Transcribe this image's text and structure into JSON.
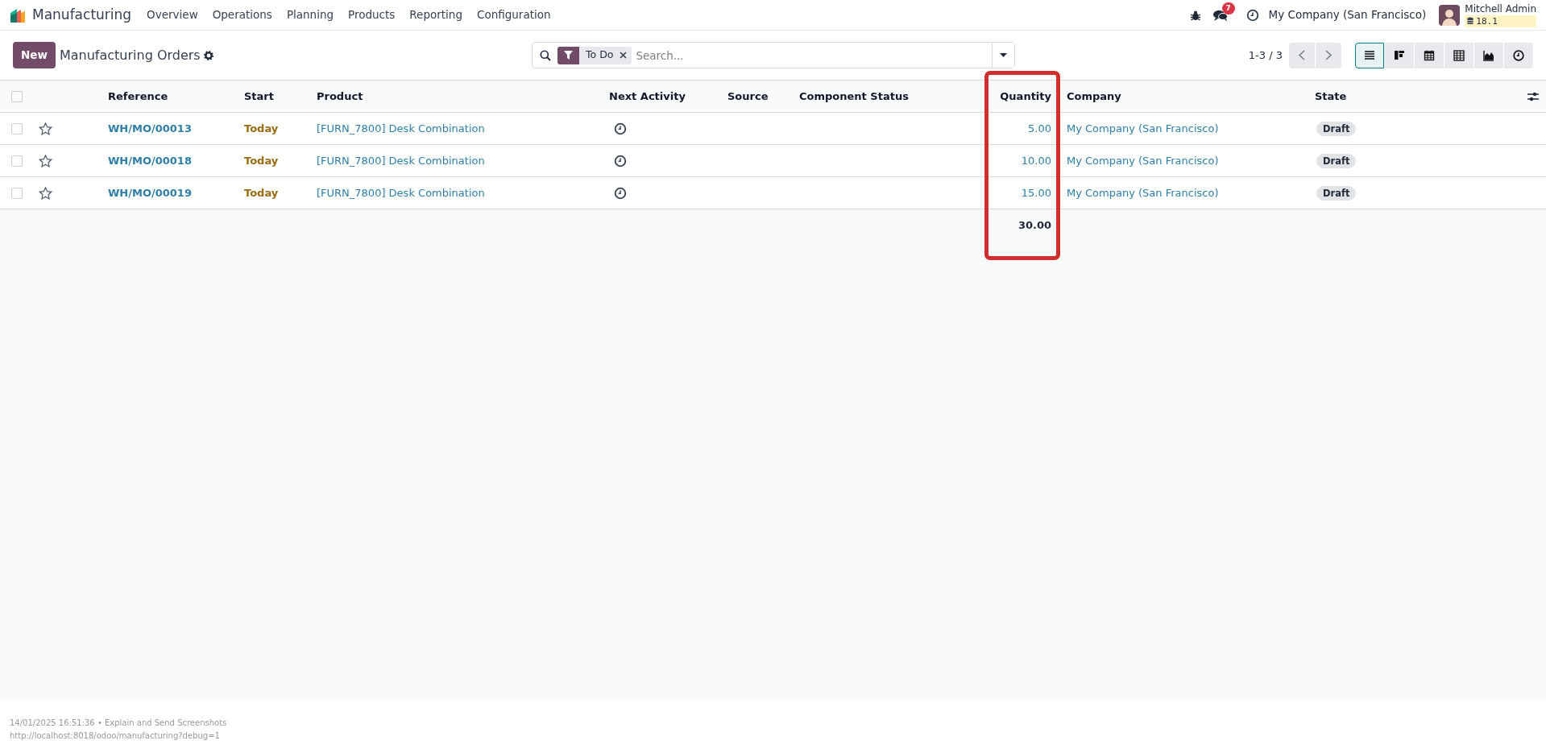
{
  "navbar": {
    "app_name": "Manufacturing",
    "menu": [
      "Overview",
      "Operations",
      "Planning",
      "Products",
      "Reporting",
      "Configuration"
    ],
    "chat_count": "7",
    "company": "My Company (San Francisco)",
    "user_name": "Mitchell Admin",
    "db_version": "18.1"
  },
  "control_panel": {
    "new_button": "New",
    "breadcrumb": "Manufacturing Orders",
    "search": {
      "facets": [
        {
          "label": "To Do"
        }
      ],
      "placeholder": "Search..."
    },
    "pager": "1-3 / 3",
    "views": [
      {
        "kind": "list",
        "selected": true
      },
      {
        "kind": "kanban",
        "selected": false
      },
      {
        "kind": "calendar",
        "selected": false
      },
      {
        "kind": "pivot",
        "selected": false
      },
      {
        "kind": "graph",
        "selected": false
      },
      {
        "kind": "activity",
        "selected": false
      }
    ]
  },
  "table": {
    "select_all_checked": false,
    "columns": [
      "Reference",
      "Start",
      "Product",
      "Next Activity",
      "Source",
      "Component Status",
      "Quantity",
      "Company",
      "State"
    ],
    "rows": [
      {
        "checked": false,
        "starred": false,
        "reference": "WH/MO/00013",
        "start": "Today",
        "product": "[FURN_7800] Desk Combination",
        "quantity": "5.00",
        "company": "My Company (San Francisco)",
        "state": "Draft"
      },
      {
        "checked": false,
        "starred": false,
        "reference": "WH/MO/00018",
        "start": "Today",
        "product": "[FURN_7800] Desk Combination",
        "quantity": "10.00",
        "company": "My Company (San Francisco)",
        "state": "Draft"
      },
      {
        "checked": false,
        "starred": false,
        "reference": "WH/MO/00019",
        "start": "Today",
        "product": "[FURN_7800] Desk Combination",
        "quantity": "15.00",
        "company": "My Company (San Francisco)",
        "state": "Draft"
      }
    ],
    "total": "30.00"
  },
  "annotations": [
    {
      "kind": "rectangle"
    }
  ],
  "footer": {
    "line_1": "14/01/2025 16:51:36 • Explain and Send Screenshots",
    "line_2": "http://localhost:8018/odoo/manufacturing?debug=1"
  }
}
